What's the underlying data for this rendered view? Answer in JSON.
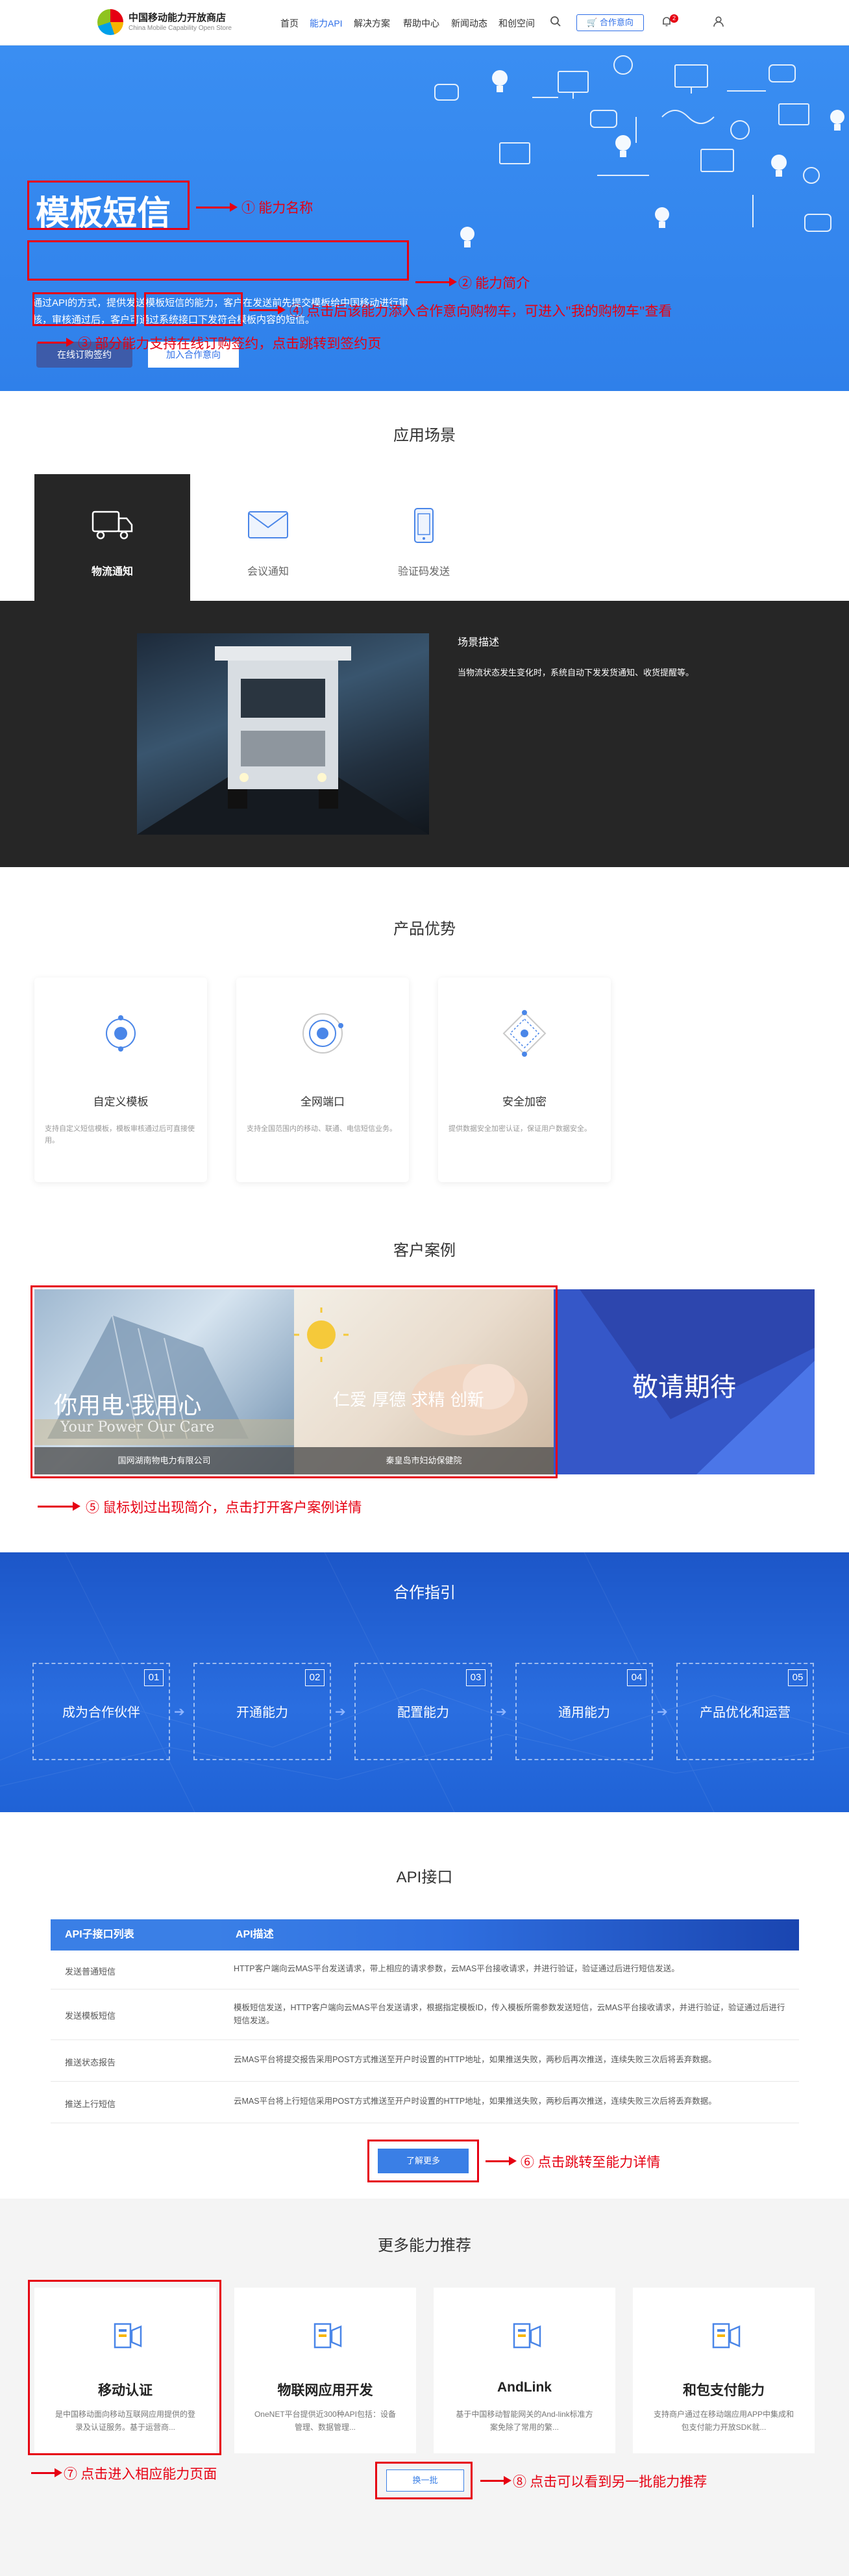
{
  "header": {
    "logo_title": "中国移动能力开放商店",
    "logo_subtitle": "China Mobile Capability Open Store",
    "nav": [
      "首页",
      "能力API",
      "解决方案",
      "帮助中心",
      "新闻动态",
      "和创空间"
    ],
    "cart_label": "合作意向",
    "notification_count": "2"
  },
  "hero": {
    "title": "模板短信",
    "description": "通过API的方式，提供发送模板短信的能力，客户在发送前先提交模板给中国移动进行审核，审核通过后，客户可通过系统接口下发符合模板内容的短信。",
    "btn_order": "在线订购签约",
    "btn_cart": "加入合作意向"
  },
  "annotations": {
    "a1": "①  能力名称",
    "a2": "②  能力简介",
    "a3": "④  点击后该能力添入合作意向购物车，可进入\"我的购物车\"查看",
    "a4": "③  部分能力支持在线订购签约，点击跳转到签约页",
    "a5": "⑤  鼠标划过出现简介，点击打开客户案例详情",
    "a6": "⑥  点击跳转至能力详情",
    "a7": "⑦  点击进入相应能力页面",
    "a8": "⑧  点击可以看到另一批能力推荐"
  },
  "scenarios": {
    "title": "应用场景",
    "tabs": [
      "物流通知",
      "会议通知",
      "验证码发送"
    ],
    "panel_heading": "场景描述",
    "panel_text": "当物流状态发生变化时，系统自动下发发货通知、收货提醒等。"
  },
  "advantages": {
    "title": "产品优势",
    "items": [
      {
        "title": "自定义模板",
        "desc": "支持自定义短信模板，模板审核通过后可直接使用。"
      },
      {
        "title": "全网端口",
        "desc": "支持全国范围内的移动、联通、电信短信业务。"
      },
      {
        "title": "安全加密",
        "desc": "提供数据安全加密认证，保证用户数据安全。"
      }
    ]
  },
  "cases": {
    "title": "客户案例",
    "items": [
      {
        "caption": "国网湖南物电力有限公司",
        "overlay": "你用电·我用心",
        "overlay2": "Your Power  Our Care"
      },
      {
        "caption": "秦皇岛市妇幼保健院",
        "overlay": "仁爱 厚德 求精 创新"
      }
    ],
    "coming": "敬请期待"
  },
  "cooperation": {
    "title": "合作指引",
    "steps": [
      {
        "num": "01",
        "label": "成为合作伙伴"
      },
      {
        "num": "02",
        "label": "开通能力"
      },
      {
        "num": "03",
        "label": "配置能力"
      },
      {
        "num": "04",
        "label": "通用能力"
      },
      {
        "num": "05",
        "label": "产品优化和运营"
      }
    ]
  },
  "api": {
    "title": "API接口",
    "col1": "API子接口列表",
    "col2": "API描述",
    "rows": [
      {
        "name": "发送普通短信",
        "desc": "HTTP客户端向云MAS平台发送请求，带上相应的请求参数，云MAS平台接收请求，并进行验证，验证通过后进行短信发送。"
      },
      {
        "name": "发送模板短信",
        "desc": "模板短信发送，HTTP客户端向云MAS平台发送请求，根据指定模板ID，传入模板所需参数发送短信，云MAS平台接收请求，并进行验证，验证通过后进行短信发送。"
      },
      {
        "name": "推送状态报告",
        "desc": "云MAS平台将提交报告采用POST方式推送至开户时设置的HTTP地址，如果推送失败，两秒后再次推送，连续失败三次后将丢弃数据。"
      },
      {
        "name": "推送上行短信",
        "desc": "云MAS平台将上行短信采用POST方式推送至开户时设置的HTTP地址，如果推送失败，两秒后再次推送，连续失败三次后将丢弃数据。"
      }
    ],
    "more_btn": "了解更多"
  },
  "more": {
    "title": "更多能力推荐",
    "items": [
      {
        "title": "移动认证",
        "desc": "是中国移动面向移动互联网应用提供的登录及认证服务。基于运营商..."
      },
      {
        "title": "物联网应用开发",
        "desc": "OneNET平台提供近300种API包括：设备管理、数据管理..."
      },
      {
        "title": "AndLink",
        "desc": "基于中国移动智能网关的And-link标准方案免除了常用的繁..."
      },
      {
        "title": "和包支付能力",
        "desc": "支持商户通过在移动端应用APP中集成和包支付能力开放SDK就..."
      }
    ],
    "swap_btn": "换一批"
  },
  "colors": {
    "brand_blue": "#2f6fe8",
    "annotation_red": "#e60012",
    "dark_panel": "#262626"
  }
}
